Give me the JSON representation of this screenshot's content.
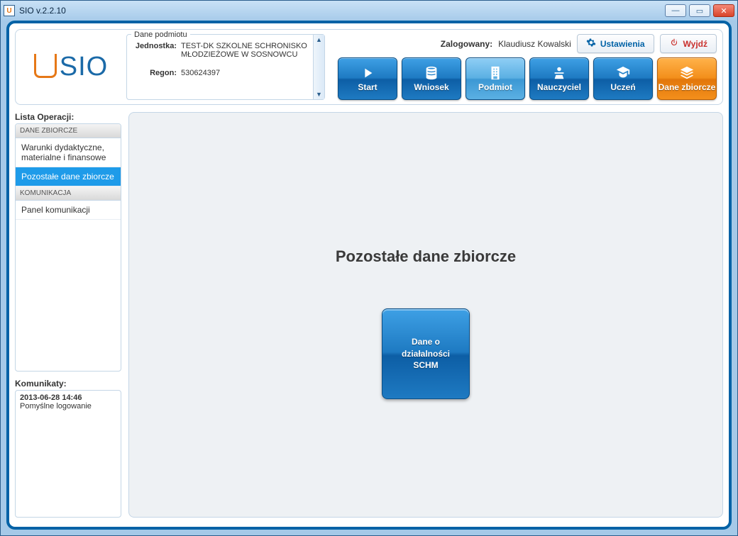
{
  "window": {
    "title": "SIO v.2.2.10"
  },
  "logo": {
    "text": "SIO"
  },
  "entity_panel": {
    "title": "Dane podmiotu",
    "row1_label": "Jednostka:",
    "row1_value": "TEST-DK SZKOLNE SCHRONISKO MŁODZIEŻOWE W SOSNOWCU",
    "row2_label": "Regon:",
    "row2_value": "530624397"
  },
  "auth": {
    "logged_label": "Zalogowany:",
    "user": "Klaudiusz Kowalski"
  },
  "buttons": {
    "settings": "Ustawienia",
    "exit": "Wyjdź"
  },
  "nav": {
    "start": "Start",
    "wniosek": "Wniosek",
    "podmiot": "Podmiot",
    "nauczyciel": "Nauczyciel",
    "uczen": "Uczeń",
    "dane_zbiorcze": "Dane zbiorcze"
  },
  "ops": {
    "title": "Lista Operacji:",
    "section1": "DANE ZBIORCZE",
    "item1": "Warunki dydaktyczne, materialne i finansowe",
    "item2": "Pozostałe dane zbiorcze",
    "section2": "KOMUNIKACJA",
    "item3": "Panel komunikacji"
  },
  "messages": {
    "title": "Komunikaty:",
    "entry_time": "2013-06-28 14:46",
    "entry_text": "Pomyślne logowanie"
  },
  "main": {
    "heading": "Pozostałe dane zbiorcze",
    "tile": "Dane o działalności SCHM"
  }
}
